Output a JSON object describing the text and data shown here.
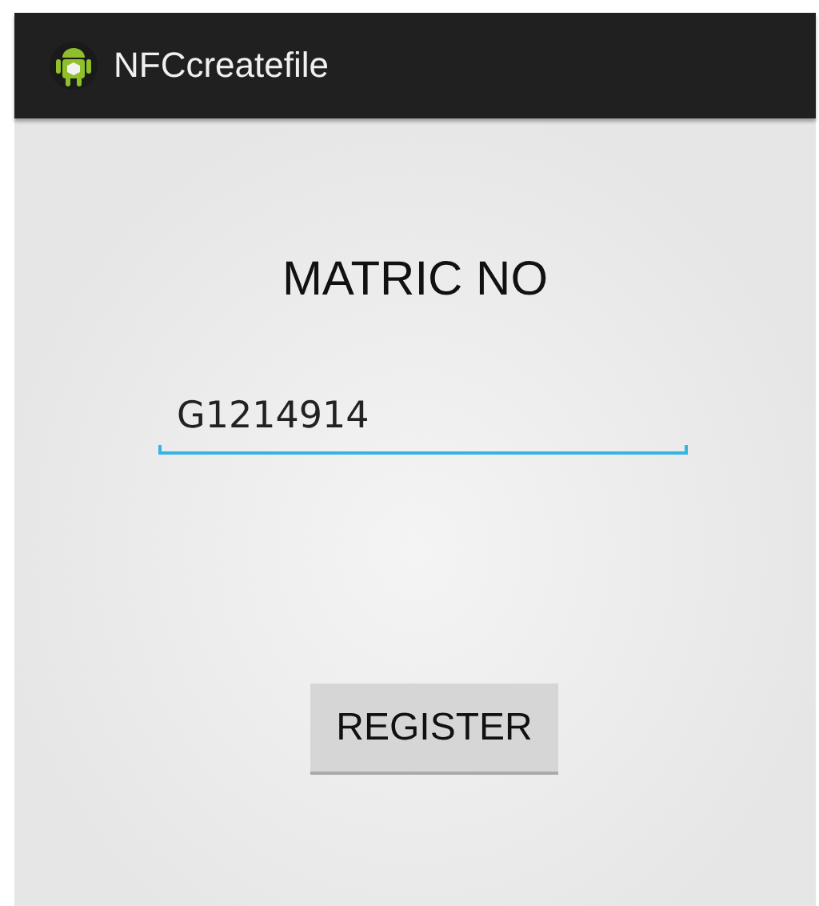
{
  "action_bar": {
    "title": "NFCcreatefile"
  },
  "label": "MATRIC NO",
  "matric_field": {
    "value": "G1214914",
    "focused": true
  },
  "register_button": {
    "label": "REGISTER"
  }
}
